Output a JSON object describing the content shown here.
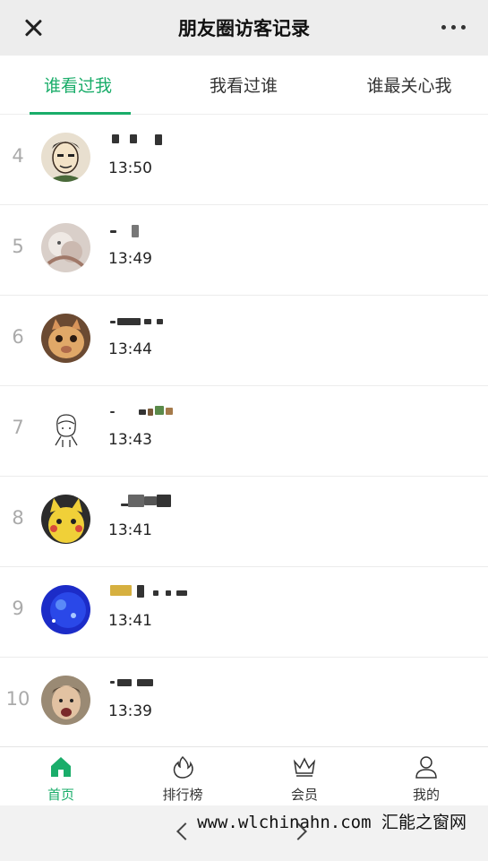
{
  "header": {
    "title": "朋友圈访客记录"
  },
  "tabs": [
    {
      "label": "谁看过我",
      "active": true
    },
    {
      "label": "我看过谁",
      "active": false
    },
    {
      "label": "谁最关心我",
      "active": false
    }
  ],
  "visitors": [
    {
      "rank": "4",
      "time": "13:50"
    },
    {
      "rank": "5",
      "time": "13:49"
    },
    {
      "rank": "6",
      "time": "13:44"
    },
    {
      "rank": "7",
      "time": "13:43"
    },
    {
      "rank": "8",
      "time": "13:41"
    },
    {
      "rank": "9",
      "time": "13:41"
    },
    {
      "rank": "10",
      "time": "13:39"
    }
  ],
  "bottom_nav": [
    {
      "label": "首页",
      "icon": "home-icon",
      "active": true
    },
    {
      "label": "排行榜",
      "icon": "flame-icon",
      "active": false
    },
    {
      "label": "会员",
      "icon": "crown-icon",
      "active": false
    },
    {
      "label": "我的",
      "icon": "person-icon",
      "active": false
    }
  ],
  "watermark": "www.wlchinahn.com 汇能之窗网",
  "colors": {
    "accent": "#1aad6a",
    "header_bg": "#ededed"
  }
}
